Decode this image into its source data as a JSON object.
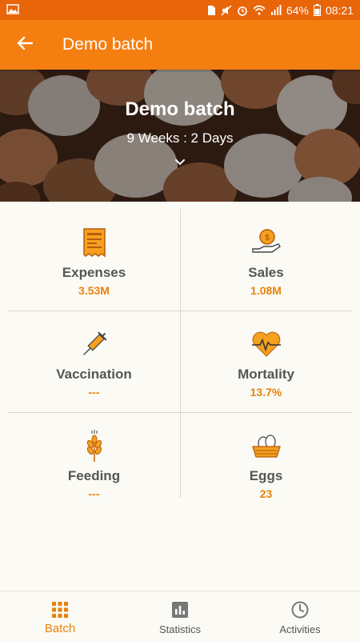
{
  "status_bar": {
    "battery": "64%",
    "time": "08:21"
  },
  "app_bar": {
    "title": "Demo batch"
  },
  "hero": {
    "title": "Demo batch",
    "age": "9 Weeks : 2 Days"
  },
  "cards": [
    {
      "label": "Expenses",
      "value": "3.53M",
      "icon": "receipt-icon"
    },
    {
      "label": "Sales",
      "value": "1.08M",
      "icon": "coin-hand-icon"
    },
    {
      "label": "Vaccination",
      "value": "---",
      "icon": "syringe-icon"
    },
    {
      "label": "Mortality",
      "value": "13.7%",
      "icon": "heartbeat-icon"
    },
    {
      "label": "Feeding",
      "value": "---",
      "icon": "wheat-icon"
    },
    {
      "label": "Eggs",
      "value": "23",
      "icon": "egg-basket-icon"
    }
  ],
  "bottom_nav": [
    {
      "label": "Batch",
      "icon": "grid-icon",
      "active": true
    },
    {
      "label": "Statistics",
      "icon": "bar-chart-icon",
      "active": false
    },
    {
      "label": "Activities",
      "icon": "clock-icon",
      "active": false
    }
  ],
  "colors": {
    "accent": "#f57e10",
    "status_bar": "#e8650a",
    "value_text": "#e8820e"
  }
}
